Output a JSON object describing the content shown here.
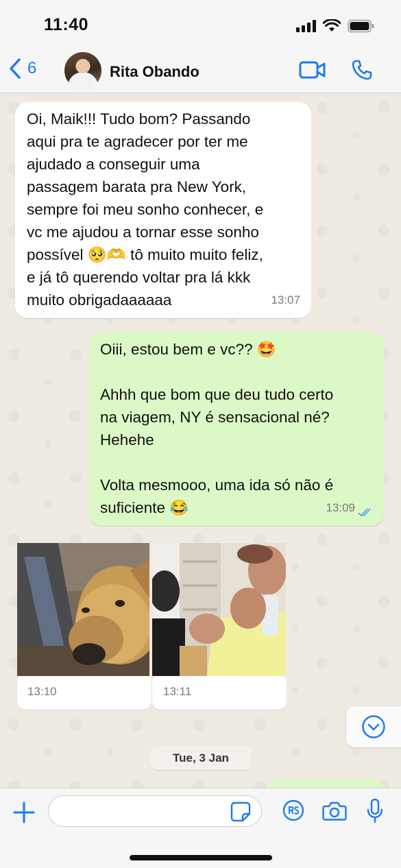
{
  "status_bar": {
    "time": "11:40"
  },
  "header": {
    "back_count": "6",
    "contact_name": "Rita Obando"
  },
  "messages": [
    {
      "direction": "incoming",
      "text": "Oi, Maik!!! Tudo bom? Passando\naqui pra te agradecer por ter me\najudado a conseguir uma\npassagem barata pra New York,\nsempre foi meu sonho conhecer, e\nvc me ajudou a tornar esse sonho\npossível 🥺🫶 tô muito muito feliz,\ne já tô querendo voltar pra lá kkk\nmuito obrigadaaaaaa",
      "time": "13:07"
    },
    {
      "direction": "outgoing",
      "text": "Oiii, estou bem e vc?? 🤩\n\nAhhh que bom que deu tudo certo\nna viagem, NY é sensacional né?\nHehehe\n\nVolta mesmooo, uma ida só não é\nsuficiente 😂",
      "time": "13:09",
      "status": "read"
    }
  ],
  "media": [
    {
      "time": "13:10",
      "icon": "photo-dog"
    },
    {
      "time": "13:11",
      "icon": "photo-man-drinking"
    }
  ],
  "date_separator": "Tue, 3 Jan",
  "input": {
    "placeholder": ""
  },
  "colors": {
    "accent": "#1a7cf0",
    "outgoing_bubble": "#dcf8c6",
    "incoming_bubble": "#ffffff",
    "chat_bg": "#efeae2"
  }
}
